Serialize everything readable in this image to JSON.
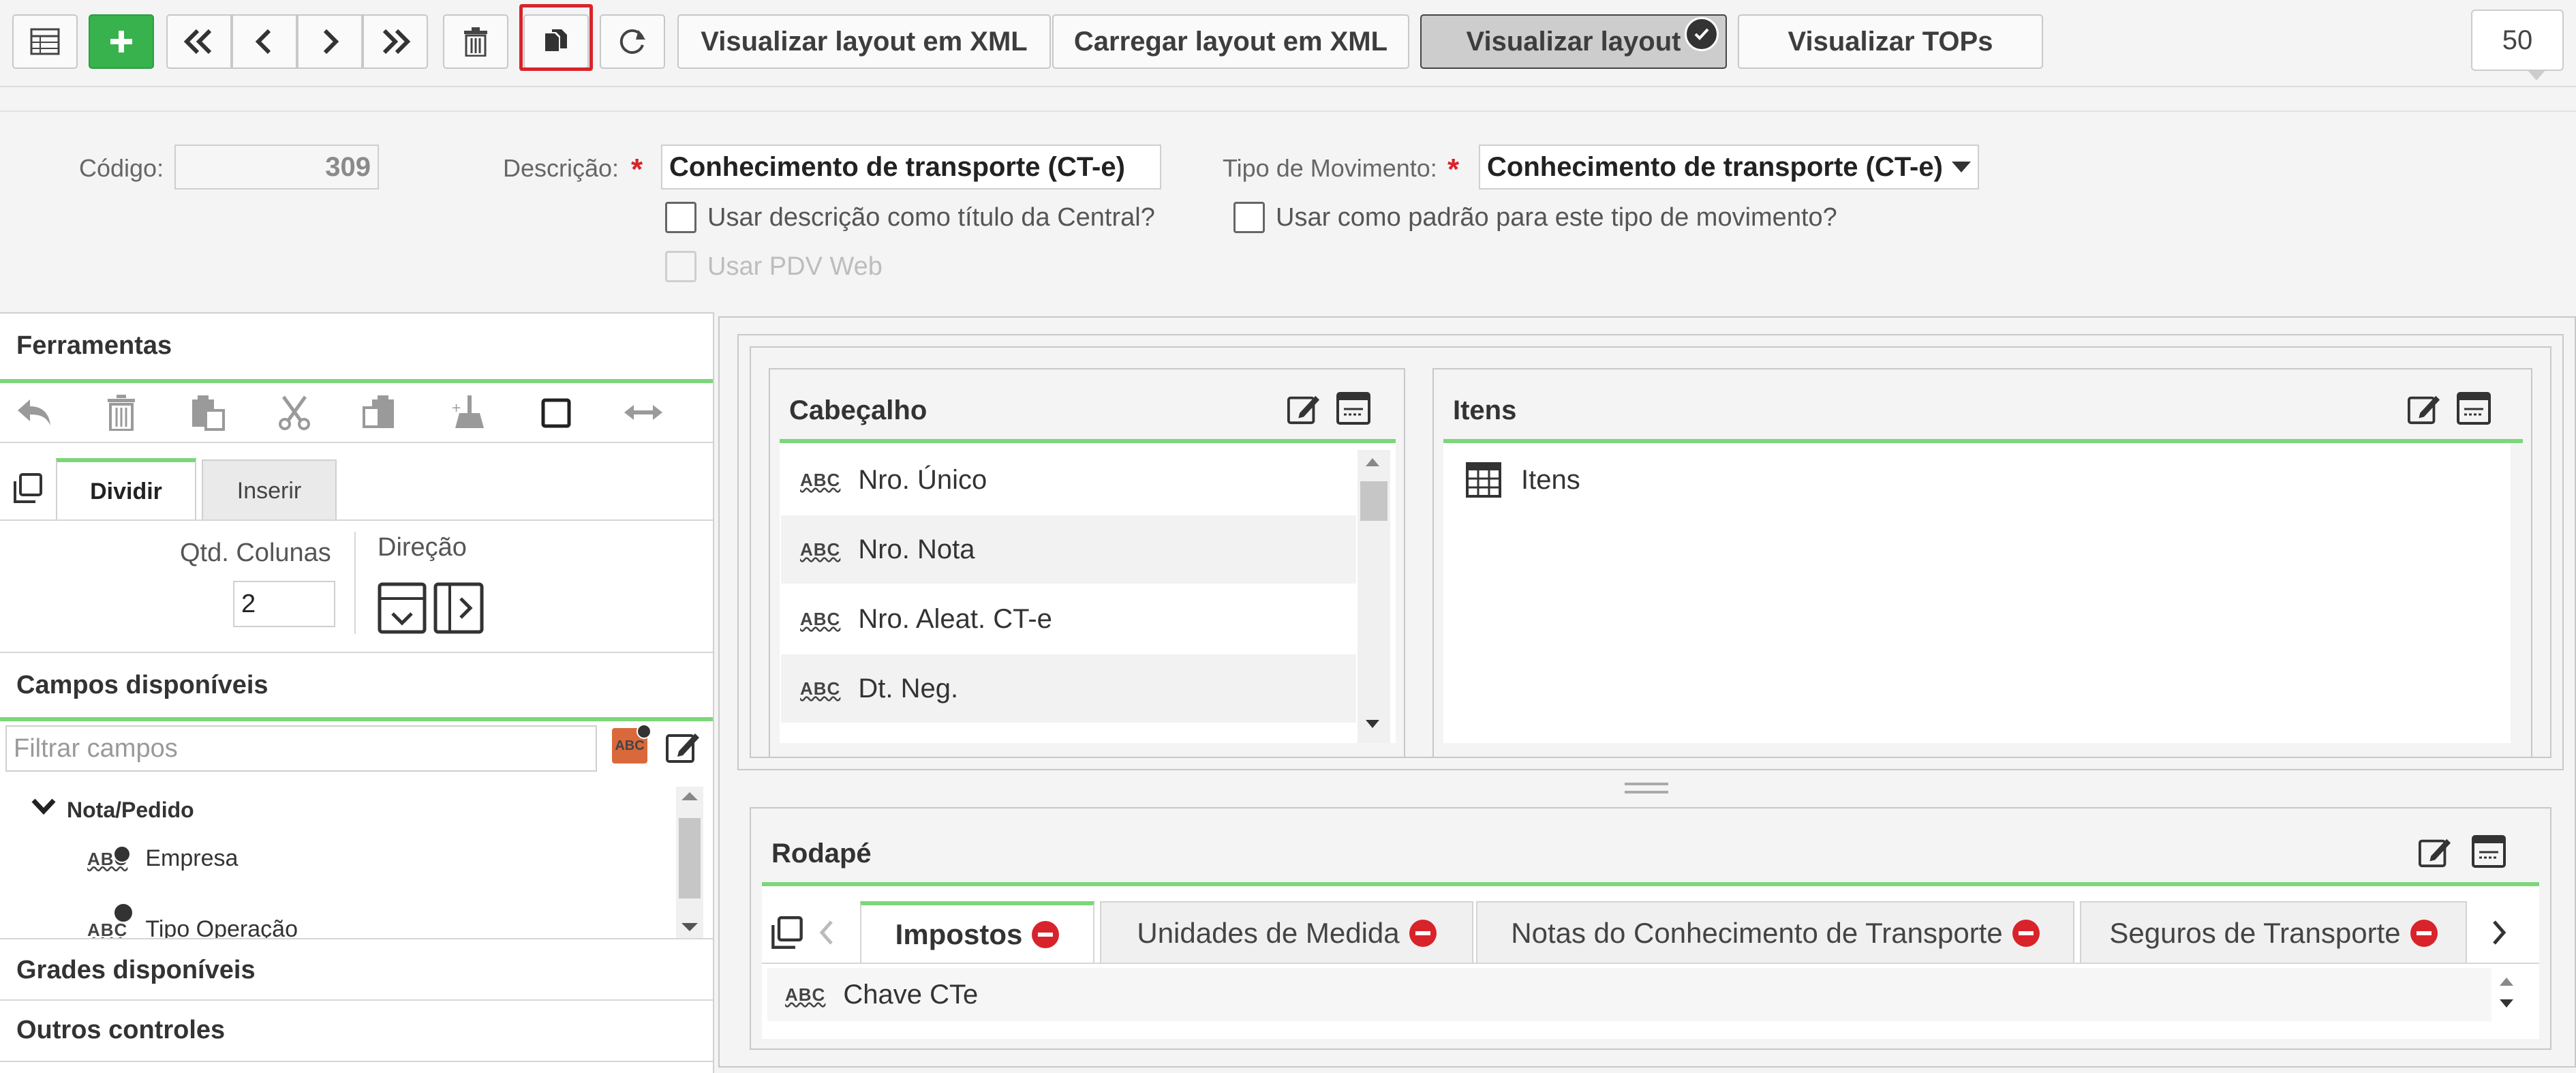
{
  "toolbar": {
    "view_xml_label": "Visualizar layout em XML",
    "load_xml_label": "Carregar layout em XML",
    "view_layout_label": "Visualizar layout",
    "view_tops_label": "Visualizar TOPs",
    "page_size": "50"
  },
  "form": {
    "codigo_label": "Código:",
    "codigo_value": "309",
    "descricao_label": "Descrição:",
    "descricao_value": "Conhecimento de transporte (CT-e)",
    "tipo_mov_label": "Tipo de Movimento:",
    "tipo_mov_value": "Conhecimento de transporte (CT-e)",
    "chk_titulo_label": "Usar descrição como título da Central?",
    "chk_padrao_label": "Usar como padrão para este tipo de movimento?",
    "chk_pdv_label": "Usar PDV Web"
  },
  "left": {
    "ferramentas_title": "Ferramentas",
    "tabs": [
      "Dividir",
      "Inserir"
    ],
    "qtd_colunas_label": "Qtd. Colunas",
    "qtd_colunas_value": "2",
    "direcao_label": "Direção",
    "campos_title": "Campos disponíveis",
    "filter_placeholder": "Filtrar campos",
    "tree_group": "Nota/Pedido",
    "tree_items": [
      "Empresa",
      "Tipo Operação"
    ],
    "grades_title": "Grades disponíveis",
    "outros_title": "Outros controles"
  },
  "layout": {
    "cabecalho": {
      "title": "Cabeçalho",
      "fields": [
        "Nro. Único",
        "Nro. Nota",
        "Nro. Aleat. CT-e",
        "Dt. Neg."
      ]
    },
    "itens": {
      "title": "Itens",
      "grid_label": "Itens"
    },
    "rodape": {
      "title": "Rodapé",
      "tabs": [
        "Impostos",
        "Unidades de Medida",
        "Notas do Conhecimento de Transporte",
        "Seguros de Transporte"
      ],
      "fields": [
        "Chave CTe"
      ]
    }
  },
  "colors": {
    "accent_green": "#37b24d",
    "tab_green": "#7cd67a",
    "required_red": "#d9232a",
    "highlight_red": "#d9232a"
  }
}
